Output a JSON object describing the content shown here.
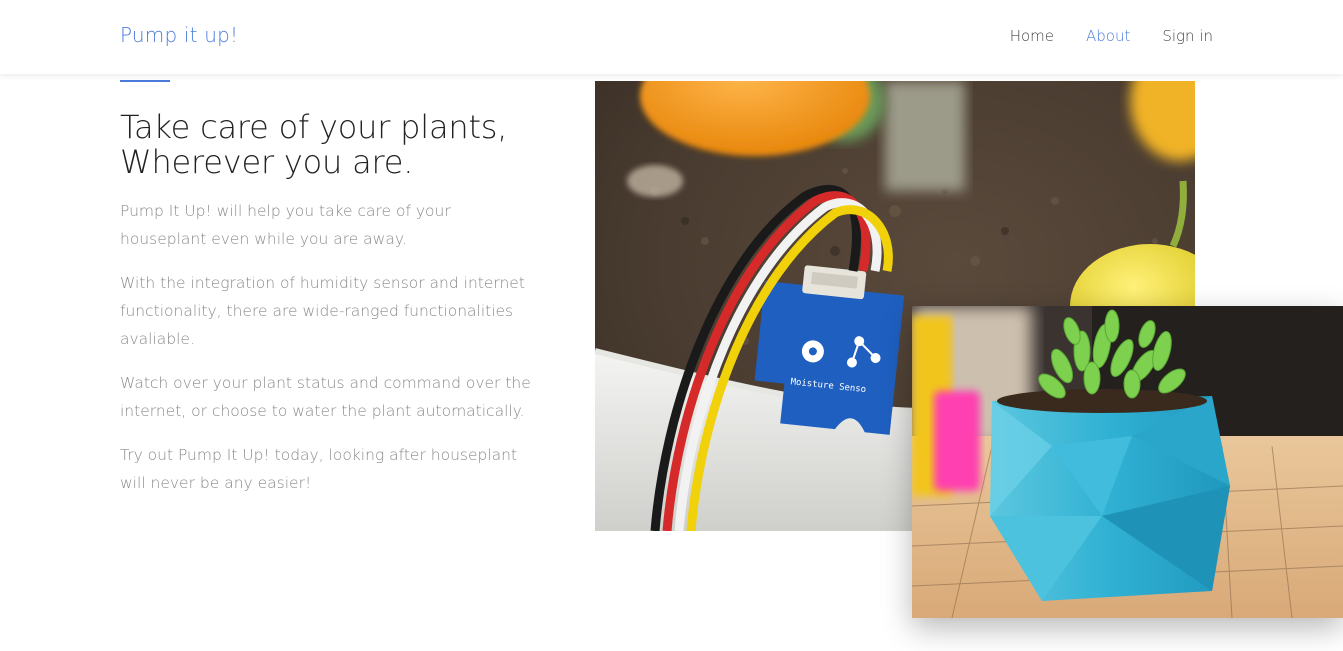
{
  "navbar": {
    "brand": "Pump it up!",
    "links": [
      {
        "label": "Home",
        "active": false
      },
      {
        "label": "About",
        "active": true
      },
      {
        "label": "Sign in",
        "active": false
      }
    ]
  },
  "hero": {
    "headline_line1": "Take care of your plants,",
    "headline_line2": "Wherever you are.",
    "paragraphs": [
      "Pump It Up! will help you take care of your houseplant even while you are away.",
      "With the integration of humidity sensor and internet functionality, there are wide-ranged functionalities avaliable.",
      "Watch over your plant status and command over the internet, or choose to water the plant automatically.",
      "Try out Pump It Up! today, looking after houseplant will never be any easier!"
    ]
  },
  "images": {
    "sensor_photo_label": "Moisture Senso",
    "sensor_version": "v1"
  },
  "colors": {
    "accent": "#4a7bdc",
    "text_dark": "#222222",
    "text_muted": "#8a8a8a",
    "nav_text": "#444444"
  }
}
